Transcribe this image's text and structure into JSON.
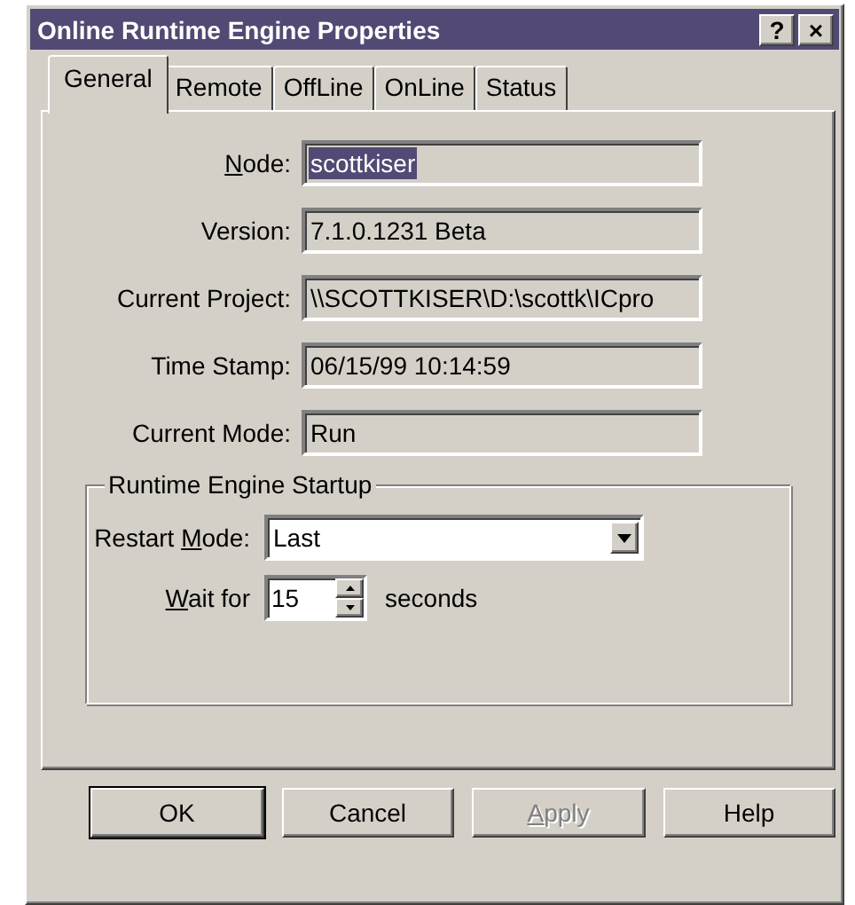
{
  "window": {
    "title": "Online Runtime Engine Properties",
    "controls": [
      "?",
      "×"
    ]
  },
  "tabs": [
    {
      "label": "General",
      "selected": true
    },
    {
      "label": "Remote",
      "selected": false
    },
    {
      "label": "OffLine",
      "selected": false
    },
    {
      "label": "OnLine",
      "selected": false
    },
    {
      "label": "Status",
      "selected": false
    }
  ],
  "fields": [
    {
      "label": {
        "key": "N",
        "rest": "ode:"
      },
      "value": "scottkiser",
      "highlighted": true
    },
    {
      "label": {
        "text": "Version:"
      },
      "value": "7.1.0.1231 Beta",
      "highlighted": false
    },
    {
      "label": {
        "text": "Current Project:"
      },
      "value": "\\\\SCOTTKISER\\D:\\scottk\\ICpro",
      "highlighted": false
    },
    {
      "label": {
        "text": "Time Stamp:"
      },
      "value": "06/15/99 10:14:59",
      "highlighted": false
    },
    {
      "label": {
        "text": "Current Mode:"
      },
      "value": "Run",
      "highlighted": false
    }
  ],
  "startup": {
    "title": "Runtime Engine Startup",
    "restart_mode": {
      "label": {
        "text": "Restart ",
        "key": "M",
        "rest": "ode:"
      },
      "value": "Last"
    },
    "wait": {
      "label": {
        "key": "W",
        "rest": "ait for"
      },
      "value": "15",
      "unit": "seconds"
    }
  },
  "buttons": [
    {
      "label": {
        "text": "OK"
      },
      "default": true,
      "disabled": false
    },
    {
      "label": {
        "text": "Cancel"
      },
      "default": false,
      "disabled": false
    },
    {
      "label": {
        "key": "A",
        "rest": "pply"
      },
      "default": false,
      "disabled": true
    },
    {
      "label": {
        "text": "Help"
      },
      "default": false,
      "disabled": false
    }
  ]
}
